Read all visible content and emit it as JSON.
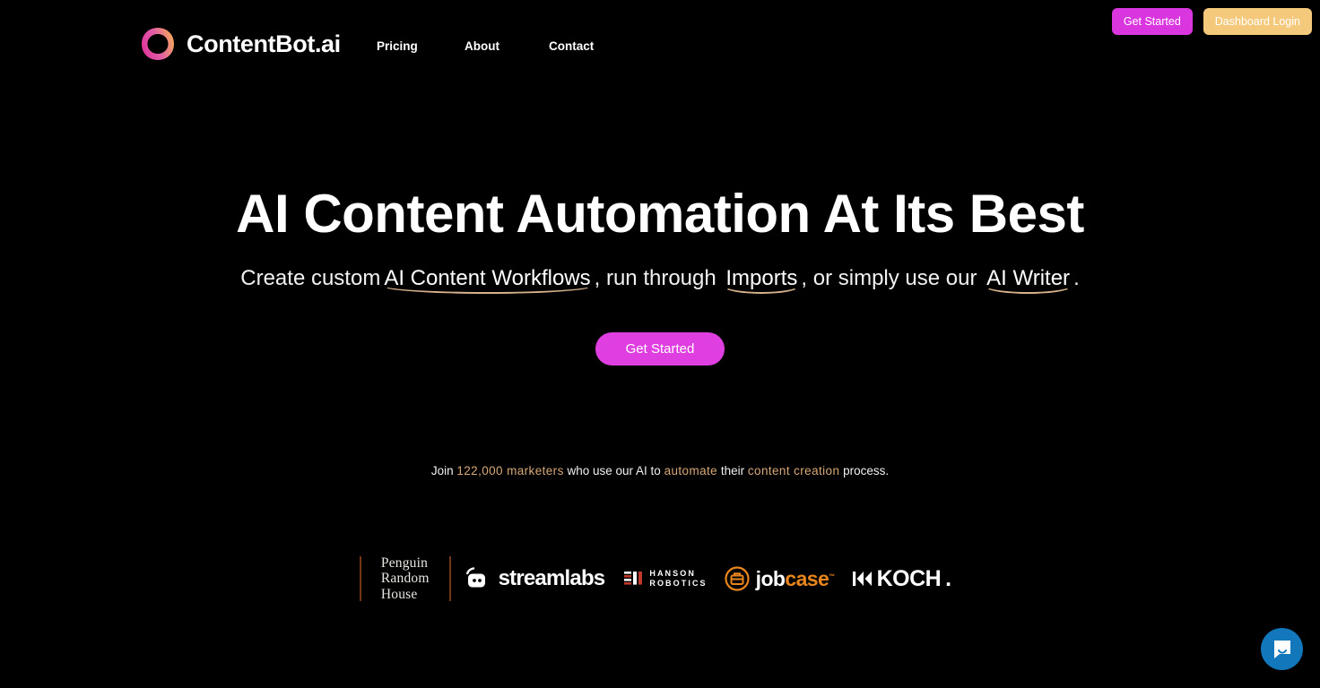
{
  "brand": {
    "name": "ContentBot.ai",
    "logo_icon": "ring-gradient-icon",
    "gradient_from": "#e0379c",
    "gradient_to": "#f5a95a"
  },
  "nav": {
    "items": [
      {
        "label": "Pricing"
      },
      {
        "label": "About"
      },
      {
        "label": "Contact"
      }
    ]
  },
  "header_actions": {
    "get_started": {
      "label": "Get Started",
      "color": "#d936e0"
    },
    "dashboard_login": {
      "label": "Dashboard Login",
      "color": "#f5c97c"
    }
  },
  "hero": {
    "title": "AI Content Automation At Its Best",
    "sub_part1": "Create custom",
    "sub_link1": "AI Content Workflows",
    "sub_part2": ", run through",
    "sub_link2": "Imports",
    "sub_part3": ", or simply use our",
    "sub_link3": "AI Writer",
    "sub_part4": ".",
    "underline_color": "#d7b28c",
    "cta_label": "Get Started",
    "cta_color": "#df3fe0"
  },
  "social_proof": {
    "part1": "Join",
    "highlight1": "122,000 marketers",
    "part2": "who use our AI to",
    "highlight2": "automate",
    "part3": "their",
    "highlight3": "content creation",
    "part4": "process.",
    "accent_color": "#d7a877"
  },
  "logos": {
    "penguin_line1": "Penguin",
    "penguin_line2": "Random",
    "penguin_line3": "House",
    "streamlabs": "streamlabs",
    "hanson_line1": "HANSON",
    "hanson_line2": "ROBOTICS",
    "jobcase_job": "job",
    "jobcase_case": "case",
    "jobcase_tm": "™",
    "koch": "KOCH",
    "koch_dot": "."
  },
  "chat": {
    "launcher_icon": "chat-bubble-icon",
    "color": "#1277bb"
  }
}
